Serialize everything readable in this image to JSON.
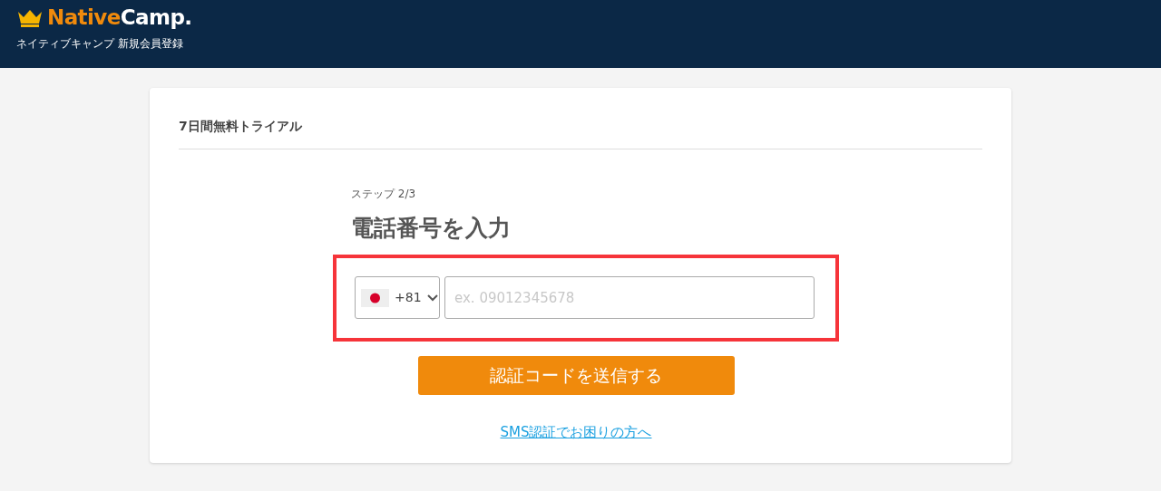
{
  "header": {
    "logo": {
      "part_1": "Native",
      "part_2": "Camp."
    },
    "subtitle": "ネイティブキャンプ 新規会員登録"
  },
  "card": {
    "title": "7日間無料トライアル",
    "step": "ステップ 2/3",
    "heading": "電話番号を入力",
    "phone": {
      "country_code": "+81",
      "placeholder": "ex. 09012345678",
      "highlighted": true
    },
    "submit_button": "認証コードを送信する",
    "help_link": "SMS認証でお困りの方へ"
  }
}
